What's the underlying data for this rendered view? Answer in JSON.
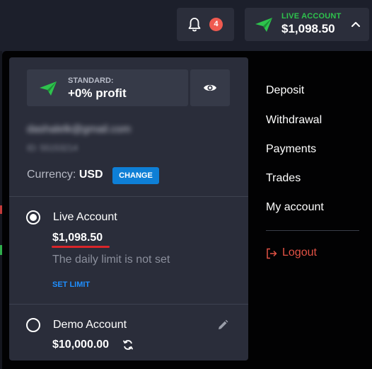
{
  "header": {
    "notifications": {
      "icon": "bell-icon",
      "count": "4",
      "badge_color": "#ef5a50"
    },
    "account_button": {
      "icon": "paper-plane-icon",
      "type_label": "LIVE ACCOUNT",
      "balance": "$1,098.50",
      "chevron_icon": "chevron-up-icon"
    }
  },
  "panel": {
    "tier": {
      "icon": "paper-plane-icon",
      "label": "STANDARD:",
      "value": "+0% profit"
    },
    "visibility_icon": "eye-icon",
    "email": "dashalelk@gmail.com",
    "user_id": "ID: 55153214",
    "currency": {
      "label": "Currency:",
      "value": "USD",
      "change_label": "CHANGE"
    },
    "accounts": [
      {
        "title": "Live Account",
        "balance": "$1,098.50",
        "selected": true,
        "limit_text": "The daily limit is not set",
        "set_limit_label": "SET LIMIT"
      },
      {
        "title": "Demo Account",
        "balance": "$10,000.00",
        "selected": false,
        "edit_icon": "pencil-icon",
        "refresh_icon": "refresh-icon"
      }
    ]
  },
  "menu": {
    "items": [
      "Deposit",
      "Withdrawal",
      "Payments",
      "Trades",
      "My account"
    ],
    "logout": {
      "label": "Logout",
      "icon": "logout-icon"
    }
  },
  "colors": {
    "accent_green": "#2ec34d",
    "accent_blue": "#0e7fd6",
    "link_blue": "#1f8fff",
    "logout_red": "#e35245",
    "underline_red": "#d9252a"
  }
}
